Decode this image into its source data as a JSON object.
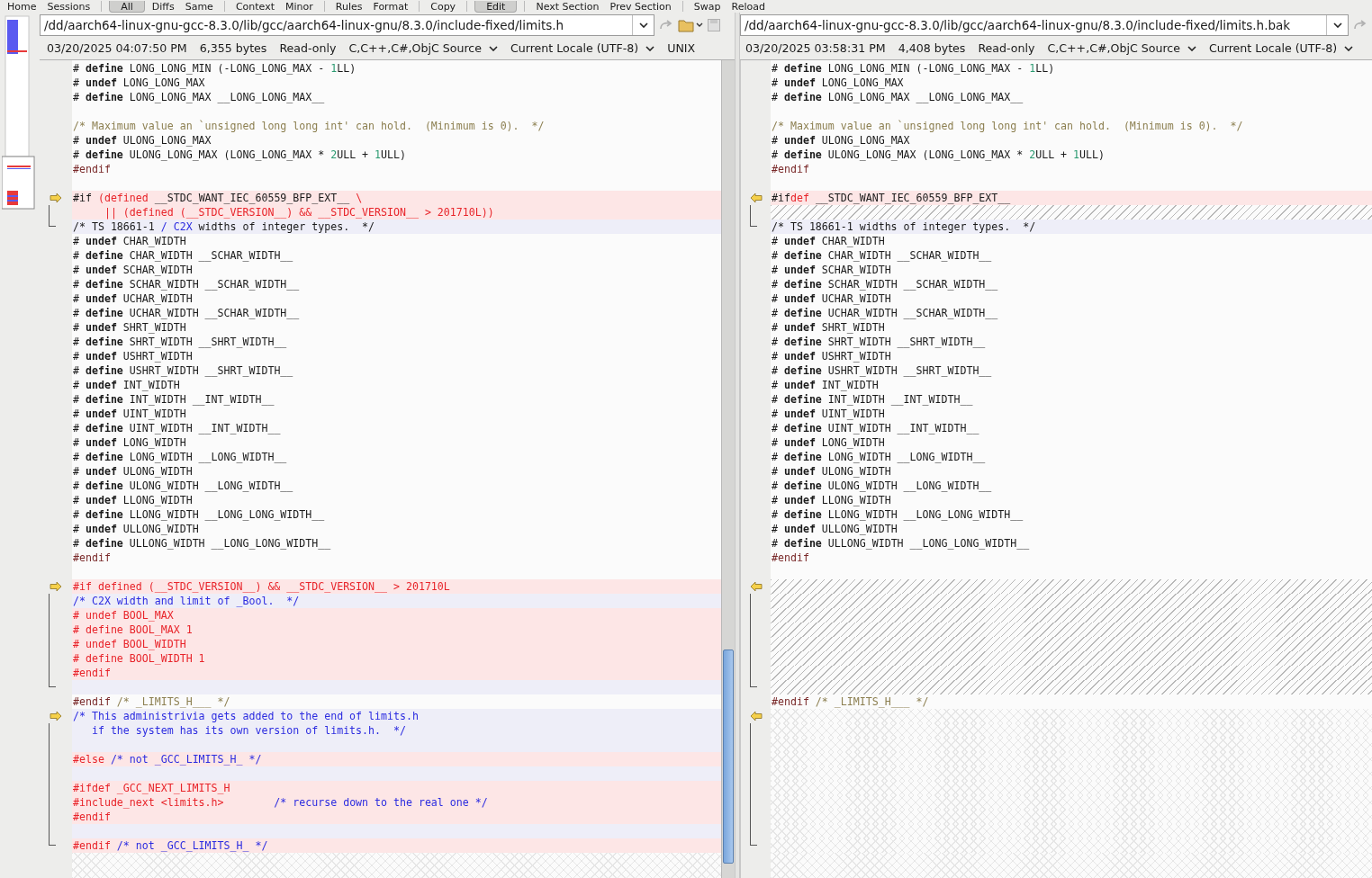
{
  "toolbar": [
    [
      {
        "label": "Home",
        "selected": false
      },
      {
        "label": "Sessions",
        "selected": false
      }
    ],
    [
      {
        "label": "All",
        "selected": true
      },
      {
        "label": "Diffs",
        "selected": false
      },
      {
        "label": "Same",
        "selected": false
      }
    ],
    [
      {
        "label": "Context",
        "selected": false
      },
      {
        "label": "Minor",
        "selected": false
      }
    ],
    [
      {
        "label": "Rules",
        "selected": false
      },
      {
        "label": "Format",
        "selected": false
      }
    ],
    [
      {
        "label": "Copy",
        "selected": false
      }
    ],
    [
      {
        "label": "Edit",
        "selected": true
      }
    ],
    [
      {
        "label": "Next Section",
        "selected": false
      },
      {
        "label": "Prev Section",
        "selected": false
      }
    ],
    [
      {
        "label": "Swap",
        "selected": false
      },
      {
        "label": "Reload",
        "selected": false
      }
    ]
  ],
  "panes": [
    {
      "path": "/dd/aarch64-linux-gnu-gcc-8.3.0/lib/gcc/aarch64-linux-gnu/8.3.0/include-fixed/limits.h",
      "info": {
        "modified": "03/20/2025 04:07:50 PM",
        "size": "6,355 bytes",
        "access": "Read-only",
        "format": "C,C++,C#,ObjC Source",
        "encoding": "Current Locale (UTF-8)",
        "line_endings": "UNIX"
      },
      "lines": [
        {
          "kind": "same",
          "segs": [
            {
              "text": "# ",
              "kind": "plain"
            },
            {
              "text": "define",
              "kind": "keyword"
            },
            {
              "text": " LONG_LONG_MIN (-LONG_LONG_MAX - ",
              "kind": "plain"
            },
            {
              "text": "1",
              "kind": "number"
            },
            {
              "text": "LL)",
              "kind": "plain"
            }
          ]
        },
        {
          "kind": "same",
          "segs": [
            {
              "text": "# ",
              "kind": "plain"
            },
            {
              "text": "undef",
              "kind": "keyword"
            },
            {
              "text": " LONG_LONG_MAX",
              "kind": "plain"
            }
          ]
        },
        {
          "kind": "same",
          "segs": [
            {
              "text": "# ",
              "kind": "plain"
            },
            {
              "text": "define",
              "kind": "keyword"
            },
            {
              "text": " LONG_LONG_MAX __LONG_LONG_MAX__",
              "kind": "plain"
            }
          ]
        },
        {
          "kind": "same"
        },
        {
          "kind": "same",
          "segs": [
            {
              "text": "/* Maximum value an `unsigned long long int' can hold.  (Minimum is 0).  */",
              "kind": "comment"
            }
          ]
        },
        {
          "kind": "same",
          "segs": [
            {
              "text": "# ",
              "kind": "plain"
            },
            {
              "text": "undef",
              "kind": "keyword"
            },
            {
              "text": " ULONG_LONG_MAX",
              "kind": "plain"
            }
          ]
        },
        {
          "kind": "same",
          "segs": [
            {
              "text": "# ",
              "kind": "plain"
            },
            {
              "text": "define",
              "kind": "keyword"
            },
            {
              "text": " ULONG_LONG_MAX (LONG_LONG_MAX * ",
              "kind": "plain"
            },
            {
              "text": "2",
              "kind": "number"
            },
            {
              "text": "ULL + ",
              "kind": "plain"
            },
            {
              "text": "1",
              "kind": "number"
            },
            {
              "text": "ULL)",
              "kind": "plain"
            }
          ]
        },
        {
          "kind": "same",
          "segs": [
            {
              "text": "#endif",
              "kind": "directive"
            }
          ]
        },
        {
          "kind": "same"
        },
        {
          "kind": "diff",
          "arrow": true,
          "segs": [
            {
              "text": "#if",
              "kind": "plain"
            },
            {
              "text": " (defined ",
              "kind": "red"
            },
            {
              "text": "__STDC_WANT_IEC_60559_BFP_EXT__",
              "kind": "plain"
            },
            {
              "text": " \\",
              "kind": "red"
            }
          ]
        },
        {
          "kind": "diff",
          "segs": [
            {
              "text": "     || (defined (__STDC_VERSION__) && __STDC_VERSION__ > 201710L))",
              "kind": "red"
            }
          ]
        },
        {
          "kind": "minor",
          "segs": [
            {
              "text": "/* TS 18661-1 ",
              "kind": "plain"
            },
            {
              "text": "/ C2X",
              "kind": "blue"
            },
            {
              "text": " widths of integer types.  */",
              "kind": "plain"
            }
          ]
        },
        {
          "kind": "same",
          "segs": [
            {
              "text": "# ",
              "kind": "plain"
            },
            {
              "text": "undef",
              "kind": "keyword"
            },
            {
              "text": " CHAR_WIDTH",
              "kind": "plain"
            }
          ]
        },
        {
          "kind": "same",
          "segs": [
            {
              "text": "# ",
              "kind": "plain"
            },
            {
              "text": "define",
              "kind": "keyword"
            },
            {
              "text": " CHAR_WIDTH __SCHAR_WIDTH__",
              "kind": "plain"
            }
          ]
        },
        {
          "kind": "same",
          "segs": [
            {
              "text": "# ",
              "kind": "plain"
            },
            {
              "text": "undef",
              "kind": "keyword"
            },
            {
              "text": " SCHAR_WIDTH",
              "kind": "plain"
            }
          ]
        },
        {
          "kind": "same",
          "segs": [
            {
              "text": "# ",
              "kind": "plain"
            },
            {
              "text": "define",
              "kind": "keyword"
            },
            {
              "text": " SCHAR_WIDTH __SCHAR_WIDTH__",
              "kind": "plain"
            }
          ]
        },
        {
          "kind": "same",
          "segs": [
            {
              "text": "# ",
              "kind": "plain"
            },
            {
              "text": "undef",
              "kind": "keyword"
            },
            {
              "text": " UCHAR_WIDTH",
              "kind": "plain"
            }
          ]
        },
        {
          "kind": "same",
          "segs": [
            {
              "text": "# ",
              "kind": "plain"
            },
            {
              "text": "define",
              "kind": "keyword"
            },
            {
              "text": " UCHAR_WIDTH __SCHAR_WIDTH__",
              "kind": "plain"
            }
          ]
        },
        {
          "kind": "same",
          "segs": [
            {
              "text": "# ",
              "kind": "plain"
            },
            {
              "text": "undef",
              "kind": "keyword"
            },
            {
              "text": " SHRT_WIDTH",
              "kind": "plain"
            }
          ]
        },
        {
          "kind": "same",
          "segs": [
            {
              "text": "# ",
              "kind": "plain"
            },
            {
              "text": "define",
              "kind": "keyword"
            },
            {
              "text": " SHRT_WIDTH __SHRT_WIDTH__",
              "kind": "plain"
            }
          ]
        },
        {
          "kind": "same",
          "segs": [
            {
              "text": "# ",
              "kind": "plain"
            },
            {
              "text": "undef",
              "kind": "keyword"
            },
            {
              "text": " USHRT_WIDTH",
              "kind": "plain"
            }
          ]
        },
        {
          "kind": "same",
          "segs": [
            {
              "text": "# ",
              "kind": "plain"
            },
            {
              "text": "define",
              "kind": "keyword"
            },
            {
              "text": " USHRT_WIDTH __SHRT_WIDTH__",
              "kind": "plain"
            }
          ]
        },
        {
          "kind": "same",
          "segs": [
            {
              "text": "# ",
              "kind": "plain"
            },
            {
              "text": "undef",
              "kind": "keyword"
            },
            {
              "text": " INT_WIDTH",
              "kind": "plain"
            }
          ]
        },
        {
          "kind": "same",
          "segs": [
            {
              "text": "# ",
              "kind": "plain"
            },
            {
              "text": "define",
              "kind": "keyword"
            },
            {
              "text": " INT_WIDTH __INT_WIDTH__",
              "kind": "plain"
            }
          ]
        },
        {
          "kind": "same",
          "segs": [
            {
              "text": "# ",
              "kind": "plain"
            },
            {
              "text": "undef",
              "kind": "keyword"
            },
            {
              "text": " UINT_WIDTH",
              "kind": "plain"
            }
          ]
        },
        {
          "kind": "same",
          "segs": [
            {
              "text": "# ",
              "kind": "plain"
            },
            {
              "text": "define",
              "kind": "keyword"
            },
            {
              "text": " UINT_WIDTH __INT_WIDTH__",
              "kind": "plain"
            }
          ]
        },
        {
          "kind": "same",
          "segs": [
            {
              "text": "# ",
              "kind": "plain"
            },
            {
              "text": "undef",
              "kind": "keyword"
            },
            {
              "text": " LONG_WIDTH",
              "kind": "plain"
            }
          ]
        },
        {
          "kind": "same",
          "segs": [
            {
              "text": "# ",
              "kind": "plain"
            },
            {
              "text": "define",
              "kind": "keyword"
            },
            {
              "text": " LONG_WIDTH __LONG_WIDTH__",
              "kind": "plain"
            }
          ]
        },
        {
          "kind": "same",
          "segs": [
            {
              "text": "# ",
              "kind": "plain"
            },
            {
              "text": "undef",
              "kind": "keyword"
            },
            {
              "text": " ULONG_WIDTH",
              "kind": "plain"
            }
          ]
        },
        {
          "kind": "same",
          "segs": [
            {
              "text": "# ",
              "kind": "plain"
            },
            {
              "text": "define",
              "kind": "keyword"
            },
            {
              "text": " ULONG_WIDTH __LONG_WIDTH__",
              "kind": "plain"
            }
          ]
        },
        {
          "kind": "same",
          "segs": [
            {
              "text": "# ",
              "kind": "plain"
            },
            {
              "text": "undef",
              "kind": "keyword"
            },
            {
              "text": " LLONG_WIDTH",
              "kind": "plain"
            }
          ]
        },
        {
          "kind": "same",
          "segs": [
            {
              "text": "# ",
              "kind": "plain"
            },
            {
              "text": "define",
              "kind": "keyword"
            },
            {
              "text": " LLONG_WIDTH __LONG_LONG_WIDTH__",
              "kind": "plain"
            }
          ]
        },
        {
          "kind": "same",
          "segs": [
            {
              "text": "# ",
              "kind": "plain"
            },
            {
              "text": "undef",
              "kind": "keyword"
            },
            {
              "text": " ULLONG_WIDTH",
              "kind": "plain"
            }
          ]
        },
        {
          "kind": "same",
          "segs": [
            {
              "text": "# ",
              "kind": "plain"
            },
            {
              "text": "define",
              "kind": "keyword"
            },
            {
              "text": " ULLONG_WIDTH __LONG_LONG_WIDTH__",
              "kind": "plain"
            }
          ]
        },
        {
          "kind": "same",
          "segs": [
            {
              "text": "#endif",
              "kind": "directive"
            }
          ]
        },
        {
          "kind": "same"
        },
        {
          "kind": "diff",
          "arrow": true,
          "segs": [
            {
              "text": "#if defined (__STDC_VERSION__) && __STDC_VERSION__ > 201710L",
              "kind": "red"
            }
          ]
        },
        {
          "kind": "minor",
          "segs": [
            {
              "text": "/* C2X width and limit of _Bool.  */",
              "kind": "blue"
            }
          ]
        },
        {
          "kind": "diff",
          "segs": [
            {
              "text": "# undef BOOL_MAX",
              "kind": "red"
            }
          ]
        },
        {
          "kind": "diff",
          "segs": [
            {
              "text": "# define BOOL_MAX 1",
              "kind": "red"
            }
          ]
        },
        {
          "kind": "diff",
          "segs": [
            {
              "text": "# undef BOOL_WIDTH",
              "kind": "red"
            }
          ]
        },
        {
          "kind": "diff",
          "segs": [
            {
              "text": "# define BOOL_WIDTH 1",
              "kind": "red"
            }
          ]
        },
        {
          "kind": "diff",
          "segs": [
            {
              "text": "#endif",
              "kind": "red"
            }
          ]
        },
        {
          "kind": "minor"
        },
        {
          "kind": "same",
          "segs": [
            {
              "text": "#endif",
              "kind": "directive"
            },
            {
              "text": " /* _LIMITS_H___ */",
              "kind": "comment"
            }
          ]
        },
        {
          "kind": "minor",
          "arrow": true,
          "segs": [
            {
              "text": "/* This administrivia gets added to the end of limits.h",
              "kind": "blue"
            }
          ]
        },
        {
          "kind": "minor",
          "segs": [
            {
              "text": "   if the system has its own version of limits.h.  */",
              "kind": "blue"
            }
          ]
        },
        {
          "kind": "minor"
        },
        {
          "kind": "diff",
          "segs": [
            {
              "text": "#else",
              "kind": "red"
            },
            {
              "text": " /* not _GCC_LIMITS_H_ */",
              "kind": "blue"
            }
          ]
        },
        {
          "kind": "minor"
        },
        {
          "kind": "diff",
          "segs": [
            {
              "text": "#ifdef _GCC_NEXT_LIMITS_H",
              "kind": "red"
            }
          ]
        },
        {
          "kind": "diff",
          "segs": [
            {
              "text": "#include_next <limits.h>",
              "kind": "red"
            },
            {
              "text": "        /* recurse down to the real one */",
              "kind": "blue"
            }
          ]
        },
        {
          "kind": "diff",
          "segs": [
            {
              "text": "#endif",
              "kind": "red"
            }
          ]
        },
        {
          "kind": "minor"
        },
        {
          "kind": "diff",
          "segs": [
            {
              "text": "#endif",
              "kind": "red"
            },
            {
              "text": " /* not _GCC_LIMITS_H_ */",
              "kind": "blue"
            }
          ]
        }
      ]
    },
    {
      "path": "/dd/aarch64-linux-gnu-gcc-8.3.0/lib/gcc/aarch64-linux-gnu/8.3.0/include-fixed/limits.h.bak",
      "info": {
        "modified": "03/20/2025 03:58:31 PM",
        "size": "4,408 bytes",
        "access": "Read-only",
        "format": "C,C++,C#,ObjC Source",
        "encoding": "Current Locale (UTF-8)"
      },
      "lines": [
        {
          "kind": "same",
          "segs": [
            {
              "text": "# ",
              "kind": "plain"
            },
            {
              "text": "define",
              "kind": "keyword"
            },
            {
              "text": " LONG_LONG_MIN (-LONG_LONG_MAX - ",
              "kind": "plain"
            },
            {
              "text": "1",
              "kind": "number"
            },
            {
              "text": "LL)",
              "kind": "plain"
            }
          ]
        },
        {
          "kind": "same",
          "segs": [
            {
              "text": "# ",
              "kind": "plain"
            },
            {
              "text": "undef",
              "kind": "keyword"
            },
            {
              "text": " LONG_LONG_MAX",
              "kind": "plain"
            }
          ]
        },
        {
          "kind": "same",
          "segs": [
            {
              "text": "# ",
              "kind": "plain"
            },
            {
              "text": "define",
              "kind": "keyword"
            },
            {
              "text": " LONG_LONG_MAX __LONG_LONG_MAX__",
              "kind": "plain"
            }
          ]
        },
        {
          "kind": "same"
        },
        {
          "kind": "same",
          "segs": [
            {
              "text": "/* Maximum value an `unsigned long long int' can hold.  (Minimum is 0).  */",
              "kind": "comment"
            }
          ]
        },
        {
          "kind": "same",
          "segs": [
            {
              "text": "# ",
              "kind": "plain"
            },
            {
              "text": "undef",
              "kind": "keyword"
            },
            {
              "text": " ULONG_LONG_MAX",
              "kind": "plain"
            }
          ]
        },
        {
          "kind": "same",
          "segs": [
            {
              "text": "# ",
              "kind": "plain"
            },
            {
              "text": "define",
              "kind": "keyword"
            },
            {
              "text": " ULONG_LONG_MAX (LONG_LONG_MAX * ",
              "kind": "plain"
            },
            {
              "text": "2",
              "kind": "number"
            },
            {
              "text": "ULL + ",
              "kind": "plain"
            },
            {
              "text": "1",
              "kind": "number"
            },
            {
              "text": "ULL)",
              "kind": "plain"
            }
          ]
        },
        {
          "kind": "same",
          "segs": [
            {
              "text": "#endif",
              "kind": "directive"
            }
          ]
        },
        {
          "kind": "same"
        },
        {
          "kind": "diff",
          "arrow": true,
          "segs": [
            {
              "text": "#if",
              "kind": "plain"
            },
            {
              "text": "def",
              "kind": "red"
            },
            {
              "text": " __STDC_WANT_IEC_60559_BFP_EXT__",
              "kind": "plain"
            }
          ]
        },
        {
          "kind": "gap"
        },
        {
          "kind": "minor",
          "segs": [
            {
              "text": "/* TS 18661-1 widths of integer types.  */",
              "kind": "plain"
            }
          ]
        },
        {
          "kind": "same",
          "segs": [
            {
              "text": "# ",
              "kind": "plain"
            },
            {
              "text": "undef",
              "kind": "keyword"
            },
            {
              "text": " CHAR_WIDTH",
              "kind": "plain"
            }
          ]
        },
        {
          "kind": "same",
          "segs": [
            {
              "text": "# ",
              "kind": "plain"
            },
            {
              "text": "define",
              "kind": "keyword"
            },
            {
              "text": " CHAR_WIDTH __SCHAR_WIDTH__",
              "kind": "plain"
            }
          ]
        },
        {
          "kind": "same",
          "segs": [
            {
              "text": "# ",
              "kind": "plain"
            },
            {
              "text": "undef",
              "kind": "keyword"
            },
            {
              "text": " SCHAR_WIDTH",
              "kind": "plain"
            }
          ]
        },
        {
          "kind": "same",
          "segs": [
            {
              "text": "# ",
              "kind": "plain"
            },
            {
              "text": "define",
              "kind": "keyword"
            },
            {
              "text": " SCHAR_WIDTH __SCHAR_WIDTH__",
              "kind": "plain"
            }
          ]
        },
        {
          "kind": "same",
          "segs": [
            {
              "text": "# ",
              "kind": "plain"
            },
            {
              "text": "undef",
              "kind": "keyword"
            },
            {
              "text": " UCHAR_WIDTH",
              "kind": "plain"
            }
          ]
        },
        {
          "kind": "same",
          "segs": [
            {
              "text": "# ",
              "kind": "plain"
            },
            {
              "text": "define",
              "kind": "keyword"
            },
            {
              "text": " UCHAR_WIDTH __SCHAR_WIDTH__",
              "kind": "plain"
            }
          ]
        },
        {
          "kind": "same",
          "segs": [
            {
              "text": "# ",
              "kind": "plain"
            },
            {
              "text": "undef",
              "kind": "keyword"
            },
            {
              "text": " SHRT_WIDTH",
              "kind": "plain"
            }
          ]
        },
        {
          "kind": "same",
          "segs": [
            {
              "text": "# ",
              "kind": "plain"
            },
            {
              "text": "define",
              "kind": "keyword"
            },
            {
              "text": " SHRT_WIDTH __SHRT_WIDTH__",
              "kind": "plain"
            }
          ]
        },
        {
          "kind": "same",
          "segs": [
            {
              "text": "# ",
              "kind": "plain"
            },
            {
              "text": "undef",
              "kind": "keyword"
            },
            {
              "text": " USHRT_WIDTH",
              "kind": "plain"
            }
          ]
        },
        {
          "kind": "same",
          "segs": [
            {
              "text": "# ",
              "kind": "plain"
            },
            {
              "text": "define",
              "kind": "keyword"
            },
            {
              "text": " USHRT_WIDTH __SHRT_WIDTH__",
              "kind": "plain"
            }
          ]
        },
        {
          "kind": "same",
          "segs": [
            {
              "text": "# ",
              "kind": "plain"
            },
            {
              "text": "undef",
              "kind": "keyword"
            },
            {
              "text": " INT_WIDTH",
              "kind": "plain"
            }
          ]
        },
        {
          "kind": "same",
          "segs": [
            {
              "text": "# ",
              "kind": "plain"
            },
            {
              "text": "define",
              "kind": "keyword"
            },
            {
              "text": " INT_WIDTH __INT_WIDTH__",
              "kind": "plain"
            }
          ]
        },
        {
          "kind": "same",
          "segs": [
            {
              "text": "# ",
              "kind": "plain"
            },
            {
              "text": "undef",
              "kind": "keyword"
            },
            {
              "text": " UINT_WIDTH",
              "kind": "plain"
            }
          ]
        },
        {
          "kind": "same",
          "segs": [
            {
              "text": "# ",
              "kind": "plain"
            },
            {
              "text": "define",
              "kind": "keyword"
            },
            {
              "text": " UINT_WIDTH __INT_WIDTH__",
              "kind": "plain"
            }
          ]
        },
        {
          "kind": "same",
          "segs": [
            {
              "text": "# ",
              "kind": "plain"
            },
            {
              "text": "undef",
              "kind": "keyword"
            },
            {
              "text": " LONG_WIDTH",
              "kind": "plain"
            }
          ]
        },
        {
          "kind": "same",
          "segs": [
            {
              "text": "# ",
              "kind": "plain"
            },
            {
              "text": "define",
              "kind": "keyword"
            },
            {
              "text": " LONG_WIDTH __LONG_WIDTH__",
              "kind": "plain"
            }
          ]
        },
        {
          "kind": "same",
          "segs": [
            {
              "text": "# ",
              "kind": "plain"
            },
            {
              "text": "undef",
              "kind": "keyword"
            },
            {
              "text": " ULONG_WIDTH",
              "kind": "plain"
            }
          ]
        },
        {
          "kind": "same",
          "segs": [
            {
              "text": "# ",
              "kind": "plain"
            },
            {
              "text": "define",
              "kind": "keyword"
            },
            {
              "text": " ULONG_WIDTH __LONG_WIDTH__",
              "kind": "plain"
            }
          ]
        },
        {
          "kind": "same",
          "segs": [
            {
              "text": "# ",
              "kind": "plain"
            },
            {
              "text": "undef",
              "kind": "keyword"
            },
            {
              "text": " LLONG_WIDTH",
              "kind": "plain"
            }
          ]
        },
        {
          "kind": "same",
          "segs": [
            {
              "text": "# ",
              "kind": "plain"
            },
            {
              "text": "define",
              "kind": "keyword"
            },
            {
              "text": " LLONG_WIDTH __LONG_LONG_WIDTH__",
              "kind": "plain"
            }
          ]
        },
        {
          "kind": "same",
          "segs": [
            {
              "text": "# ",
              "kind": "plain"
            },
            {
              "text": "undef",
              "kind": "keyword"
            },
            {
              "text": " ULLONG_WIDTH",
              "kind": "plain"
            }
          ]
        },
        {
          "kind": "same",
          "segs": [
            {
              "text": "# ",
              "kind": "plain"
            },
            {
              "text": "define",
              "kind": "keyword"
            },
            {
              "text": " ULLONG_WIDTH __LONG_LONG_WIDTH__",
              "kind": "plain"
            }
          ]
        },
        {
          "kind": "same",
          "segs": [
            {
              "text": "#endif",
              "kind": "directive"
            }
          ]
        },
        {
          "kind": "same"
        },
        {
          "kind": "gap",
          "arrow": true
        },
        {
          "kind": "gap"
        },
        {
          "kind": "gap"
        },
        {
          "kind": "gap"
        },
        {
          "kind": "gap"
        },
        {
          "kind": "gap"
        },
        {
          "kind": "gap"
        },
        {
          "kind": "gap"
        },
        {
          "kind": "same",
          "segs": [
            {
              "text": "#endif",
              "kind": "directive"
            },
            {
              "text": " /* _LIMITS_H___ */",
              "kind": "comment"
            }
          ]
        },
        {
          "kind": "end",
          "arrow": true
        },
        {
          "kind": "end"
        },
        {
          "kind": "end"
        },
        {
          "kind": "end"
        },
        {
          "kind": "end"
        },
        {
          "kind": "end"
        },
        {
          "kind": "end"
        },
        {
          "kind": "end"
        },
        {
          "kind": "end"
        },
        {
          "kind": "end"
        }
      ]
    }
  ]
}
